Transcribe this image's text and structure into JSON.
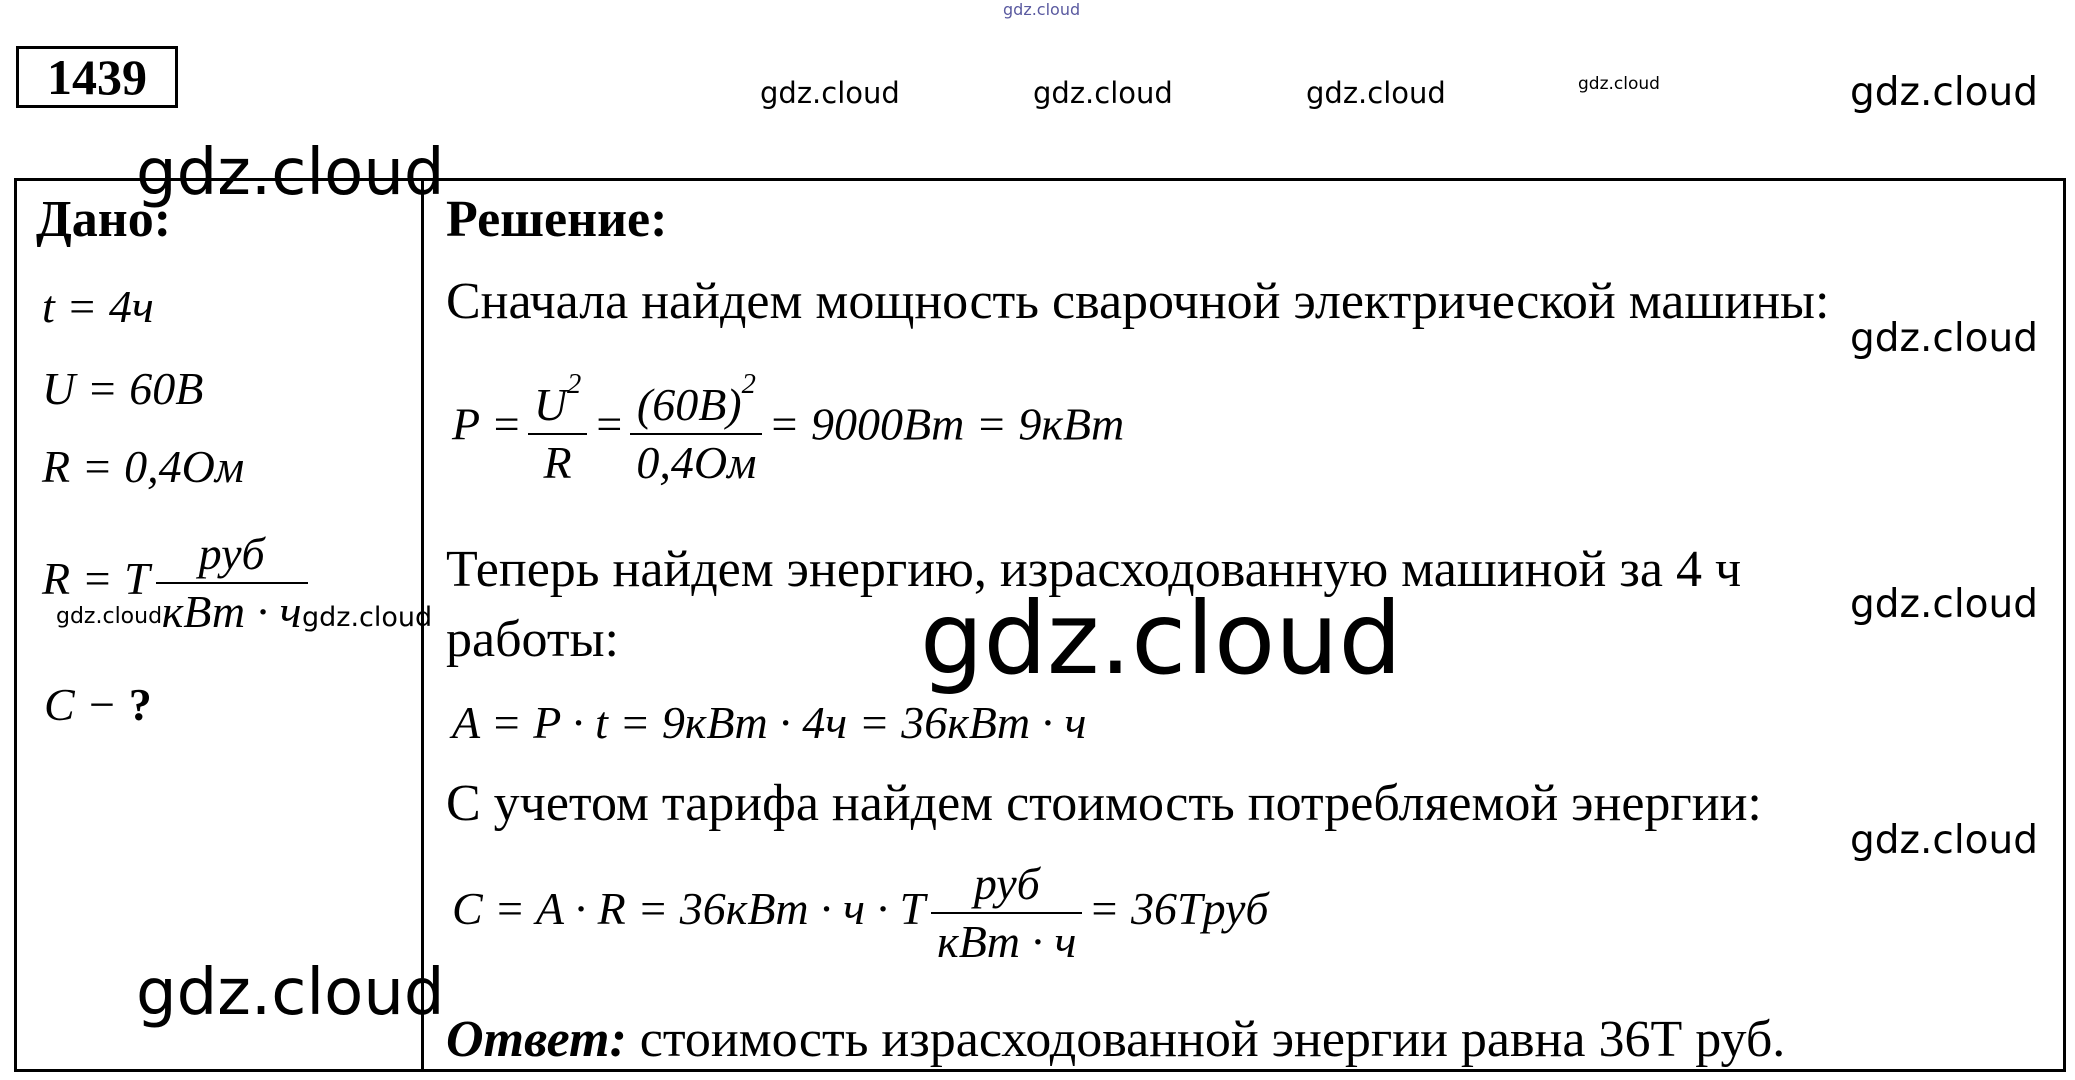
{
  "watermark": "gdz.cloud",
  "problem_number": "1439",
  "given": {
    "header": "Дано:",
    "t": "t = 4ч",
    "U": "U = 60B",
    "R": "R = 0,4Ом",
    "tariff_left": "R = T",
    "tariff_num": "руб",
    "tariff_den": "кВт · ч",
    "find": "C −",
    "find_q": "?"
  },
  "solution": {
    "header": "Решение:",
    "line1": "Сначала найдем мощность сварочной электрической машины:",
    "f1_left": "P =",
    "f1_num1": "U",
    "f1_sup1": "2",
    "f1_den1": "R",
    "f1_eq": "=",
    "f1_num2": "(60B)",
    "f1_sup2": "2",
    "f1_den2": "0,4Ом",
    "f1_right": "= 9000Bm = 9кBm",
    "line2": "Теперь найдем энергию, израсходованную машиной за 4 ч",
    "line2b": "работы:",
    "f2": "A = P · t = 9кBm · 4ч = 36кBm · ч",
    "line3": "С учетом тарифа найдем стоимость потребляемой энергии:",
    "f3_left": "C = A · R = 36кBm · ч · T",
    "f3_num": "руб",
    "f3_den": "кBm · ч",
    "f3_right": "= 36Tруб",
    "answer_label": "Ответ:",
    "answer_text": "стоимость израсходованной энергии равна 36Т руб."
  }
}
